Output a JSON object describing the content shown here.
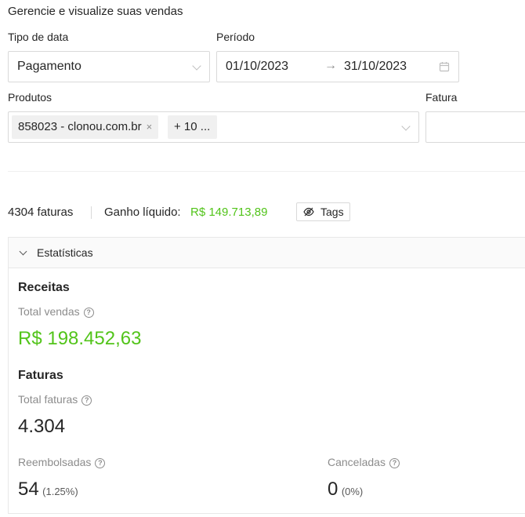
{
  "page": {
    "subtitle": "Gerencie e visualize suas vendas"
  },
  "filters": {
    "date_type_label": "Tipo de data",
    "date_type_value": "Pagamento",
    "period_label": "Período",
    "period_start": "01/10/2023",
    "period_arrow": "→",
    "period_end": "31/10/2023",
    "products_label": "Produtos",
    "product_tags": [
      {
        "label": "858023 - clonou.com.br",
        "close": "×"
      },
      {
        "label": "+ 10 ..."
      }
    ],
    "invoice_label": "Fatura",
    "invoice_value": ""
  },
  "summary": {
    "invoices": "4304 faturas",
    "net_label": "Ganho líquido:",
    "net_value": "R$ 149.713,89",
    "tags_label": "Tags"
  },
  "stats": {
    "panel_title": "Estatísticas",
    "revenue": {
      "title": "Receitas",
      "total_sales_label": "Total vendas",
      "total_sales_value": "R$ 198.452,63"
    },
    "invoices": {
      "title": "Faturas",
      "total_label": "Total faturas",
      "total_value": "4.304",
      "refunded_label": "Reembolsadas",
      "refunded_value": "54",
      "refunded_pct": "(1.25%)",
      "canceled_label": "Canceladas",
      "canceled_value": "0",
      "canceled_pct": "(0%)"
    },
    "help_glyph": "?"
  },
  "colors": {
    "accent_green": "#52c41a",
    "border": "#d9d9d9",
    "muted_text": "#8c8c8c"
  }
}
